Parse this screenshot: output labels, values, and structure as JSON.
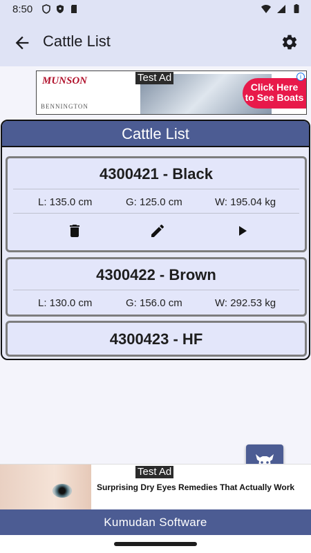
{
  "status_bar": {
    "time": "8:50",
    "icons": [
      "shield-icon",
      "vpn-shield-icon",
      "sd-card-icon",
      "wifi-icon",
      "signal-icon",
      "battery-icon"
    ]
  },
  "app_bar": {
    "title": "Cattle List",
    "back_icon": "arrow-back-icon",
    "settings_icon": "gear-icon"
  },
  "top_ad": {
    "label": "Test Ad",
    "brand": "MUNSON",
    "brand_sub": "BENNINGTON",
    "cta_line1": "Click Here",
    "cta_line2": "to See Boats"
  },
  "panel": {
    "title": "Cattle List"
  },
  "cattle": [
    {
      "name": "4300421 - Black",
      "length": "L: 135.0 cm",
      "girth": "G: 125.0 cm",
      "weight": "W: 195.04 kg",
      "expanded": true
    },
    {
      "name": "4300422 - Brown",
      "length": "L: 130.0 cm",
      "girth": "G: 156.0 cm",
      "weight": "W: 292.53 kg",
      "expanded": false
    },
    {
      "name": "4300423 - HF",
      "expanded": false
    }
  ],
  "actions": {
    "delete_icon": "trash-icon",
    "edit_icon": "pencil-icon",
    "open_icon": "play-icon"
  },
  "fab": {
    "icon": "cow-add-icon"
  },
  "bottom_ad": {
    "label": "Test Ad",
    "headline": "Surprising Dry Eyes Remedies That Actually Work"
  },
  "footer": {
    "text": "Kumudan Software"
  },
  "colors": {
    "primary": "#4c5c93",
    "app_bar": "#dfe3f5",
    "card": "#e3e6fa",
    "ad_cta": "#e8194a"
  }
}
